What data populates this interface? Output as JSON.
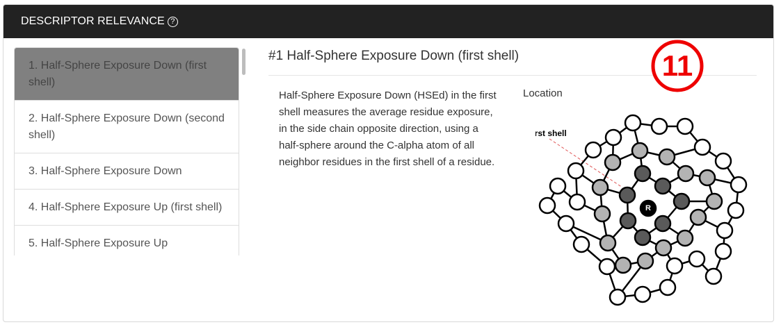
{
  "header": {
    "title": "DESCRIPTOR RELEVANCE",
    "help_icon": "question-circle-icon"
  },
  "descriptor_list": {
    "items": [
      {
        "label": "1. Half-Sphere Exposure Down (first shell)",
        "active": true
      },
      {
        "label": "2. Half-Sphere Exposure Down (second shell)",
        "active": false
      },
      {
        "label": "3. Half-Sphere Exposure Down",
        "active": false
      },
      {
        "label": "4. Half-Sphere Exposure Up (first shell)",
        "active": false
      },
      {
        "label": "5. Half-Sphere Exposure Up",
        "active": false
      }
    ]
  },
  "detail": {
    "title": "#1 Half-Sphere Exposure Down (first shell)",
    "description": "Half-Sphere Exposure Down (HSEd) in the first shell measures the average residue exposure, in the side chain opposite direction, using a half-sphere around the C-alpha atom of all neighbor residues in the first shell of a residue.",
    "location_label": "Location",
    "badge_number": "11",
    "diagram": {
      "shell_label": "First shell",
      "center_label": "R"
    }
  },
  "colors": {
    "header_bg": "#222222",
    "active_item_bg": "#808080",
    "badge_red": "#ee0000",
    "node_center": "#000000",
    "node_dark": "#5a5a5a",
    "node_light": "#b3b3b3",
    "node_outer": "#ffffff"
  }
}
